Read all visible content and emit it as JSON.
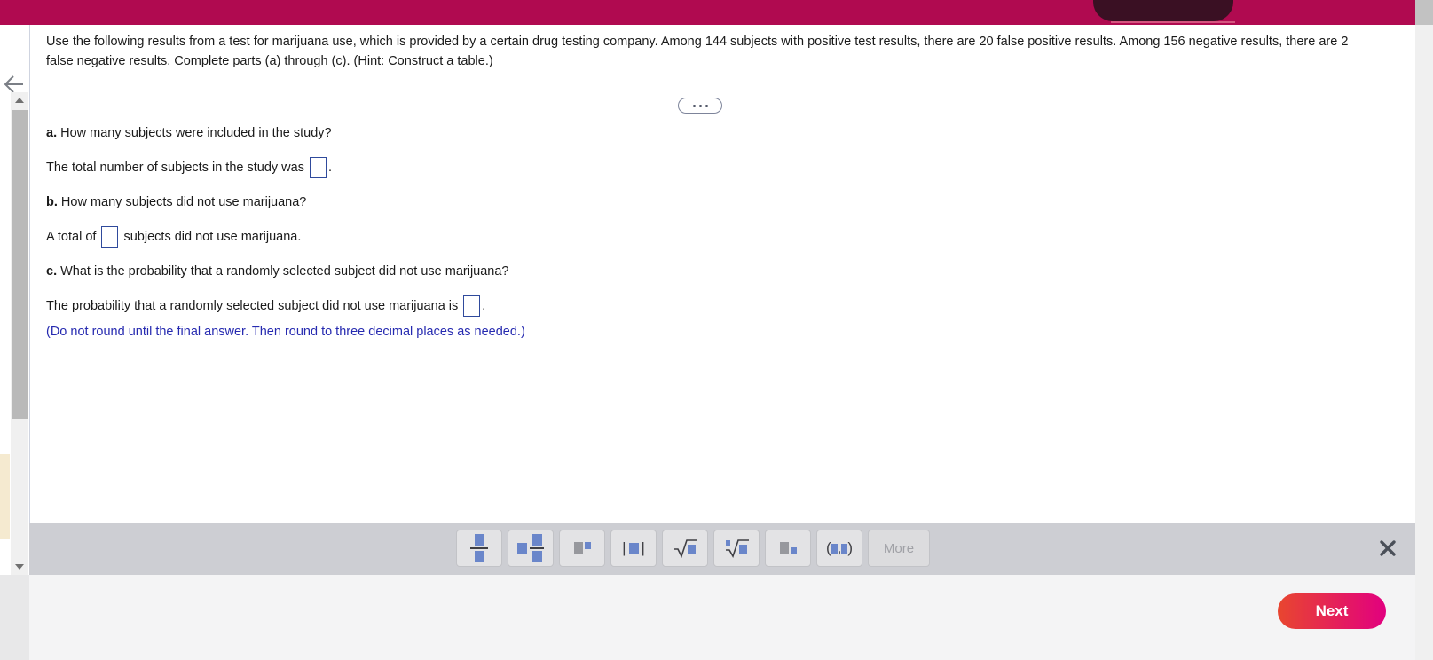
{
  "header": {
    "tab_label": ""
  },
  "left_rail": {
    "back_icon": "back-arrow-icon"
  },
  "question": {
    "prompt": "Use the following results from a test for marijuana use, which is provided by a certain drug testing company. Among 144 subjects with positive test results, there are 20 false positive results. Among 156 negative results, there are 2 false negative results. Complete parts (a) through (c). (Hint: Construct a table.)",
    "divider_icon": "ellipsis-pill-icon",
    "parts": [
      {
        "label": "a.",
        "text": " How many subjects were included in the study?"
      },
      {
        "label": "b.",
        "text": " How many subjects did not use marijuana?"
      },
      {
        "label": "c.",
        "text": " What is the probability that a randomly selected subject did not use marijuana?"
      }
    ],
    "answer_a_prefix": "The total number of subjects in the study was ",
    "answer_a_suffix": ".",
    "answer_a_value": "",
    "answer_b_prefix": "A total of ",
    "answer_b_suffix": " subjects did not use marijuana.",
    "answer_b_value": "",
    "answer_c_prefix": "The probability that a randomly selected subject did not use marijuana is ",
    "answer_c_suffix": ".",
    "answer_c_value": "",
    "rounding_hint": "(Do not round until the final answer. Then round to three decimal places as needed.)",
    "hint_color": "#262ab0"
  },
  "math_toolbar": {
    "buttons": [
      {
        "name": "fraction-button",
        "glyph": "fraction",
        "label": ""
      },
      {
        "name": "mixed-number-button",
        "glyph": "mixed-fraction",
        "label": ""
      },
      {
        "name": "exponent-button",
        "glyph": "power",
        "label": ""
      },
      {
        "name": "absolute-value-button",
        "glyph": "absolute-value",
        "label": ""
      },
      {
        "name": "square-root-button",
        "glyph": "sqrt",
        "label": ""
      },
      {
        "name": "nth-root-button",
        "glyph": "nth-root",
        "label": ""
      },
      {
        "name": "subscript-button",
        "glyph": "subscript",
        "label": ""
      },
      {
        "name": "interval-button",
        "glyph": "interval",
        "label": ""
      }
    ],
    "more_label": "More",
    "close_icon": "close-icon"
  },
  "footer": {
    "next_label": "Next"
  },
  "colors": {
    "header_magenta": "#b00a50",
    "next_gradient_start": "#e8462f",
    "next_gradient_end": "#e2007f",
    "toolbar_gray": "#cdced3",
    "answer_box_border": "#2f4a9c"
  }
}
